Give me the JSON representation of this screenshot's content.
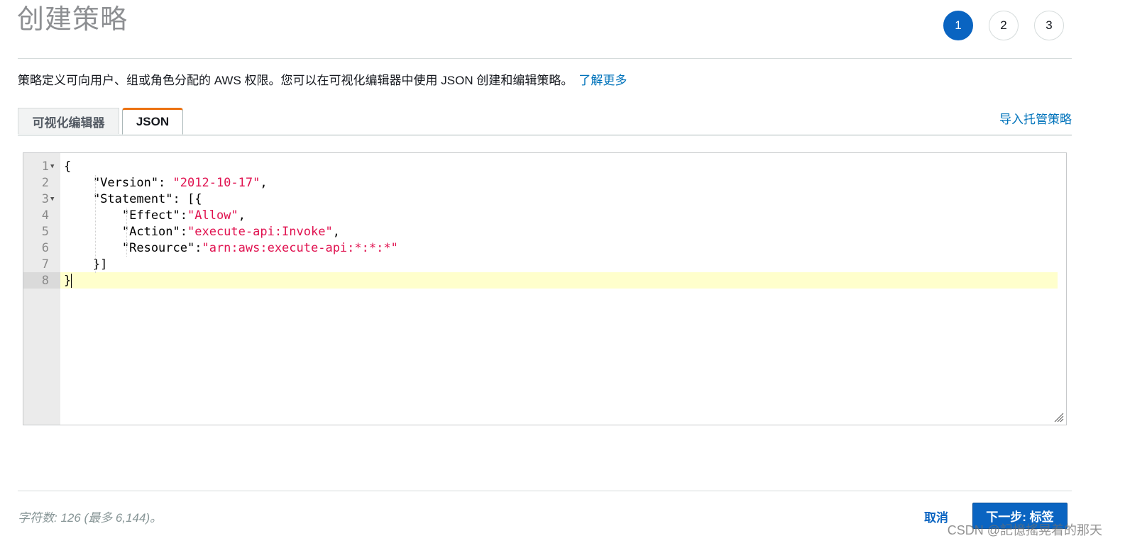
{
  "header": {
    "title": "创建策略",
    "steps": [
      "1",
      "2",
      "3"
    ],
    "active_step": "1"
  },
  "description": {
    "text": "策略定义可向用户、组或角色分配的 AWS 权限。您可以在可视化编辑器中使用 JSON 创建和编辑策略。",
    "learn_more": "了解更多"
  },
  "tabs": {
    "visual_editor": "可视化编辑器",
    "json": "JSON",
    "active": "json",
    "import_link": "导入托管策略"
  },
  "editor": {
    "current_line": 8,
    "lines": [
      {
        "num": "1",
        "fold": true,
        "parts": [
          {
            "t": "{",
            "c": "p"
          }
        ]
      },
      {
        "num": "2",
        "fold": false,
        "parts": [
          {
            "t": "    \"Version\": ",
            "c": "p"
          },
          {
            "t": "\"2012-10-17\"",
            "c": "s"
          },
          {
            "t": ",",
            "c": "p"
          }
        ]
      },
      {
        "num": "3",
        "fold": true,
        "parts": [
          {
            "t": "    \"Statement\": [{",
            "c": "p"
          }
        ]
      },
      {
        "num": "4",
        "fold": false,
        "parts": [
          {
            "t": "        \"Effect\":",
            "c": "p"
          },
          {
            "t": "\"Allow\"",
            "c": "s"
          },
          {
            "t": ",",
            "c": "p"
          }
        ]
      },
      {
        "num": "5",
        "fold": false,
        "parts": [
          {
            "t": "        \"Action\":",
            "c": "p"
          },
          {
            "t": "\"execute-api:Invoke\"",
            "c": "s"
          },
          {
            "t": ",",
            "c": "p"
          }
        ]
      },
      {
        "num": "6",
        "fold": false,
        "parts": [
          {
            "t": "        \"Resource\":",
            "c": "p"
          },
          {
            "t": "\"arn:aws:execute-api:*:*:*\"",
            "c": "s"
          }
        ]
      },
      {
        "num": "7",
        "fold": false,
        "parts": [
          {
            "t": "    }]",
            "c": "p"
          }
        ]
      },
      {
        "num": "8",
        "fold": false,
        "parts": [
          {
            "t": "}",
            "c": "p"
          }
        ]
      }
    ]
  },
  "footer": {
    "char_count": "字符数: 126 (最多 6,144)。",
    "cancel": "取消",
    "next": "下一步: 标签"
  },
  "watermark": "CSDN @記憶搖晃着的那天",
  "colors": {
    "primary": "#0a64c1",
    "link": "#0073bb",
    "tab_accent": "#ec7211",
    "json_string": "#e0114f",
    "active_line": "#ffffcc"
  }
}
